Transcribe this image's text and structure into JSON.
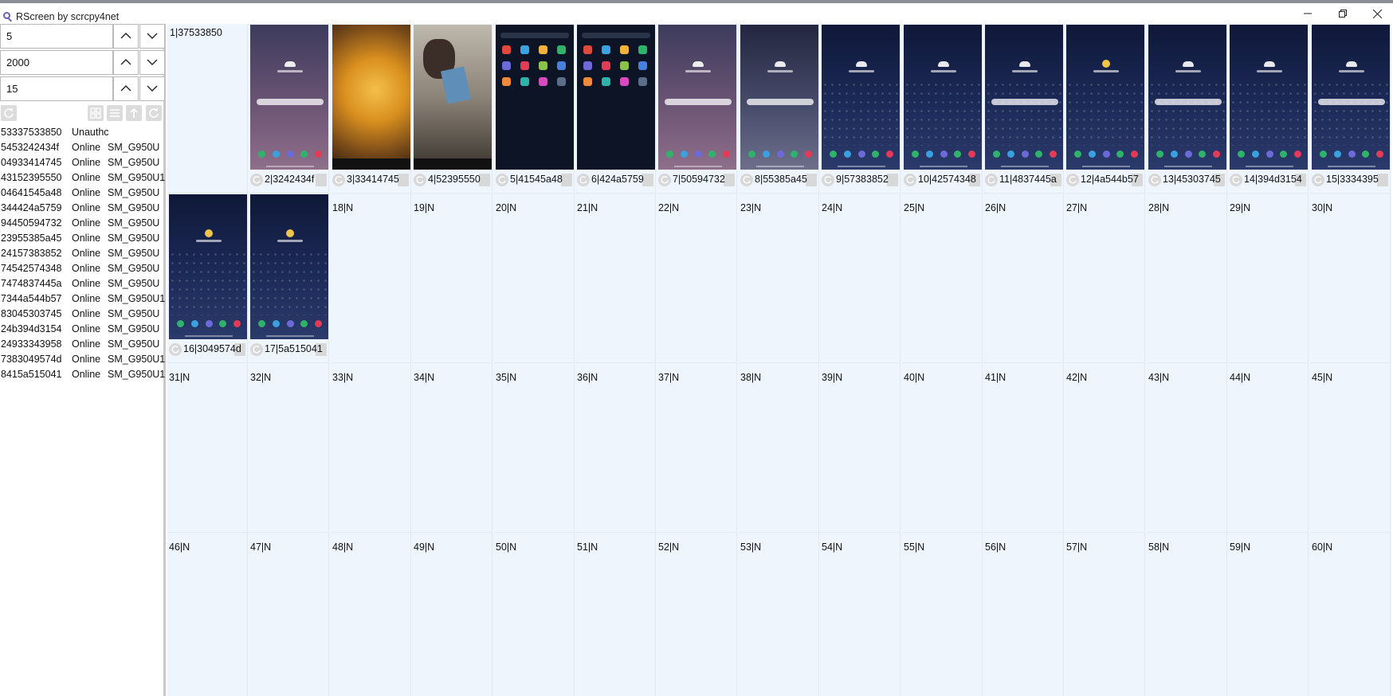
{
  "window": {
    "title": "RScreen by scrcpy4net",
    "minimize": "—",
    "restore": "❐",
    "close": "✕"
  },
  "controls": {
    "spinners": [
      {
        "value": "5"
      },
      {
        "value": "2000"
      },
      {
        "value": "15"
      }
    ],
    "toolbar_icons": [
      "refresh-icon",
      "grid-view-icon",
      "list-view-icon",
      "upload-icon",
      "rotate-icon"
    ]
  },
  "devices": [
    {
      "id": "53337533850",
      "status": "Unauthc",
      "model": ""
    },
    {
      "id": "5453242434f",
      "status": "Online",
      "model": "SM_G950U"
    },
    {
      "id": "04933414745",
      "status": "Online",
      "model": "SM_G950U"
    },
    {
      "id": "43152395550",
      "status": "Online",
      "model": "SM_G950U1"
    },
    {
      "id": "04641545a48",
      "status": "Online",
      "model": "SM_G950U"
    },
    {
      "id": "344424a5759",
      "status": "Online",
      "model": "SM_G950U"
    },
    {
      "id": "94450594732",
      "status": "Online",
      "model": "SM_G950U"
    },
    {
      "id": "23955385a45",
      "status": "Online",
      "model": "SM_G950U"
    },
    {
      "id": "24157383852",
      "status": "Online",
      "model": "SM_G950U"
    },
    {
      "id": "74542574348",
      "status": "Online",
      "model": "SM_G950U"
    },
    {
      "id": "7474837445a",
      "status": "Online",
      "model": "SM_G950U"
    },
    {
      "id": "7344a544b57",
      "status": "Online",
      "model": "SM_G950U1"
    },
    {
      "id": "83045303745",
      "status": "Online",
      "model": "SM_G950U"
    },
    {
      "id": "24b394d3154",
      "status": "Online",
      "model": "SM_G950U"
    },
    {
      "id": "24933343958",
      "status": "Online",
      "model": "SM_G950U"
    },
    {
      "id": "7383049574d",
      "status": "Online",
      "model": "SM_G950U1"
    },
    {
      "id": "8415a515041",
      "status": "Online",
      "model": "SM_G950U1"
    }
  ],
  "grid": {
    "cells": [
      {
        "label": "1|37533850",
        "screen": "none"
      },
      {
        "label": "2|3242434f",
        "screen": "lock1"
      },
      {
        "label": "3|33414745",
        "screen": "food"
      },
      {
        "label": "4|52395550",
        "screen": "dog"
      },
      {
        "label": "5|41545a48",
        "screen": "app"
      },
      {
        "label": "6|424a5759",
        "screen": "app"
      },
      {
        "label": "7|50594732",
        "screen": "lock1"
      },
      {
        "label": "8|55385a45",
        "screen": "lock2"
      },
      {
        "label": "9|57383852",
        "screen": "night"
      },
      {
        "label": "10|42574348",
        "screen": "night"
      },
      {
        "label": "11|4837445a",
        "screen": "night-search"
      },
      {
        "label": "12|4a544b57",
        "screen": "night-sun"
      },
      {
        "label": "13|45303745",
        "screen": "night-search"
      },
      {
        "label": "14|394d3154",
        "screen": "night"
      },
      {
        "label": "15|3334395",
        "screen": "night-search"
      },
      {
        "label": "16|3049574d",
        "screen": "night-sun"
      },
      {
        "label": "17|5a515041",
        "screen": "night-sun"
      },
      {
        "label": "18|N"
      },
      {
        "label": "19|N"
      },
      {
        "label": "20|N"
      },
      {
        "label": "21|N"
      },
      {
        "label": "22|N"
      },
      {
        "label": "23|N"
      },
      {
        "label": "24|N"
      },
      {
        "label": "25|N"
      },
      {
        "label": "26|N"
      },
      {
        "label": "27|N"
      },
      {
        "label": "28|N"
      },
      {
        "label": "29|N"
      },
      {
        "label": "30|N"
      },
      {
        "label": "31|N"
      },
      {
        "label": "32|N"
      },
      {
        "label": "33|N"
      },
      {
        "label": "34|N"
      },
      {
        "label": "35|N"
      },
      {
        "label": "36|N"
      },
      {
        "label": "37|N"
      },
      {
        "label": "38|N"
      },
      {
        "label": "39|N"
      },
      {
        "label": "40|N"
      },
      {
        "label": "41|N"
      },
      {
        "label": "42|N"
      },
      {
        "label": "43|N"
      },
      {
        "label": "44|N"
      },
      {
        "label": "45|N"
      },
      {
        "label": "46|N"
      },
      {
        "label": "47|N"
      },
      {
        "label": "48|N"
      },
      {
        "label": "49|N"
      },
      {
        "label": "50|N"
      },
      {
        "label": "51|N"
      },
      {
        "label": "52|N"
      },
      {
        "label": "53|N"
      },
      {
        "label": "54|N"
      },
      {
        "label": "55|N"
      },
      {
        "label": "56|N"
      },
      {
        "label": "57|N"
      },
      {
        "label": "58|N"
      },
      {
        "label": "59|N"
      },
      {
        "label": "60|N"
      }
    ]
  },
  "colors": {
    "grid_background": "#eef5fc",
    "app_icon": "#6b5fb8"
  }
}
